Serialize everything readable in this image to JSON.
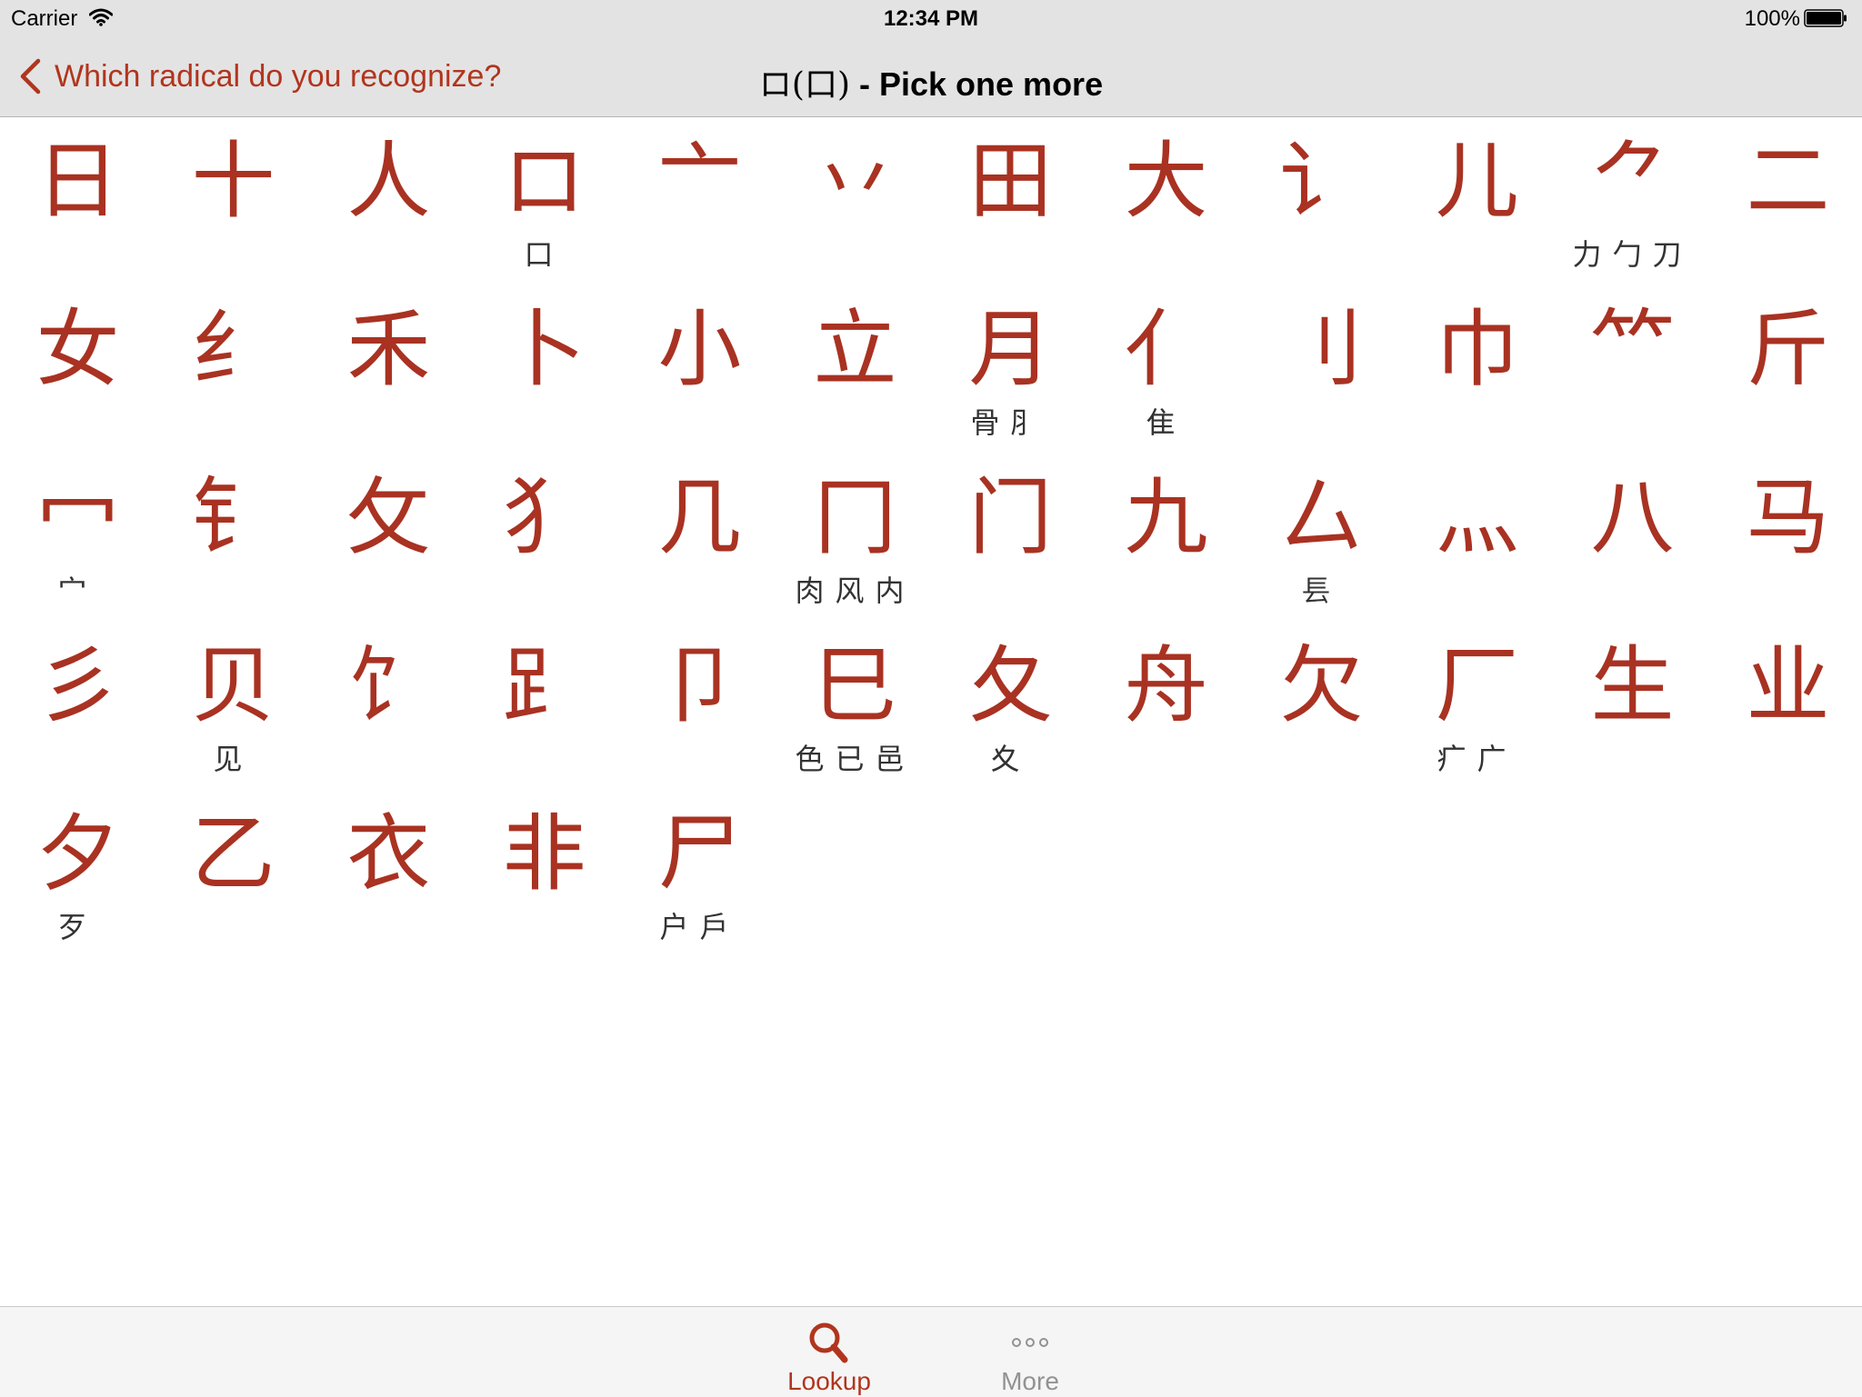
{
  "status_bar": {
    "carrier": "Carrier",
    "time": "12:34 PM",
    "battery": "100%"
  },
  "nav": {
    "back_label": "Which radical do you recognize?",
    "title_radical": "ロ(口)",
    "title_text": " - Pick one more"
  },
  "accent_color": "#b1351e",
  "radicals": [
    {
      "char": "日",
      "variants": ""
    },
    {
      "char": "十",
      "variants": ""
    },
    {
      "char": "人",
      "variants": ""
    },
    {
      "char": "ロ",
      "variants": "口"
    },
    {
      "char": "亠",
      "variants": ""
    },
    {
      "char": "丷",
      "variants": ""
    },
    {
      "char": "田",
      "variants": ""
    },
    {
      "char": "大",
      "variants": ""
    },
    {
      "char": "讠",
      "variants": ""
    },
    {
      "char": "儿",
      "variants": ""
    },
    {
      "char": "⺈",
      "variants": "力勹刀"
    },
    {
      "char": "二",
      "variants": ""
    },
    {
      "char": "女",
      "variants": ""
    },
    {
      "char": "纟",
      "variants": ""
    },
    {
      "char": "禾",
      "variants": ""
    },
    {
      "char": "卜",
      "variants": ""
    },
    {
      "char": "小",
      "variants": ""
    },
    {
      "char": "立",
      "variants": ""
    },
    {
      "char": "月",
      "variants": "骨⺼"
    },
    {
      "char": "亻",
      "variants": "隹"
    },
    {
      "char": "刂",
      "variants": ""
    },
    {
      "char": "巾",
      "variants": ""
    },
    {
      "char": "⺮",
      "variants": ""
    },
    {
      "char": "斤",
      "variants": ""
    },
    {
      "char": "冖",
      "variants": "宀"
    },
    {
      "char": "钅",
      "variants": ""
    },
    {
      "char": "攵",
      "variants": ""
    },
    {
      "char": "犭",
      "variants": ""
    },
    {
      "char": "几",
      "variants": ""
    },
    {
      "char": "冂",
      "variants": "肉风内"
    },
    {
      "char": "门",
      "variants": ""
    },
    {
      "char": "九",
      "variants": ""
    },
    {
      "char": "厶",
      "variants": "镸"
    },
    {
      "char": "灬",
      "variants": ""
    },
    {
      "char": "八",
      "variants": ""
    },
    {
      "char": "马",
      "variants": ""
    },
    {
      "char": "彡",
      "variants": ""
    },
    {
      "char": "贝",
      "variants": "见"
    },
    {
      "char": "饣",
      "variants": ""
    },
    {
      "char": "⻊",
      "variants": ""
    },
    {
      "char": "卩",
      "variants": ""
    },
    {
      "char": "巳",
      "variants": "色已邑"
    },
    {
      "char": "夂",
      "variants": "夊"
    },
    {
      "char": "舟",
      "variants": ""
    },
    {
      "char": "欠",
      "variants": ""
    },
    {
      "char": "厂",
      "variants": "疒广"
    },
    {
      "char": "生",
      "variants": ""
    },
    {
      "char": "业",
      "variants": ""
    },
    {
      "char": "夕",
      "variants": "歹"
    },
    {
      "char": "乙",
      "variants": ""
    },
    {
      "char": "衣",
      "variants": ""
    },
    {
      "char": "非",
      "variants": ""
    },
    {
      "char": "尸",
      "variants": "户戶"
    }
  ],
  "tabs": [
    {
      "label": "Lookup",
      "icon": "search-icon",
      "selected": true
    },
    {
      "label": "More",
      "icon": "more-icon",
      "selected": false
    }
  ]
}
